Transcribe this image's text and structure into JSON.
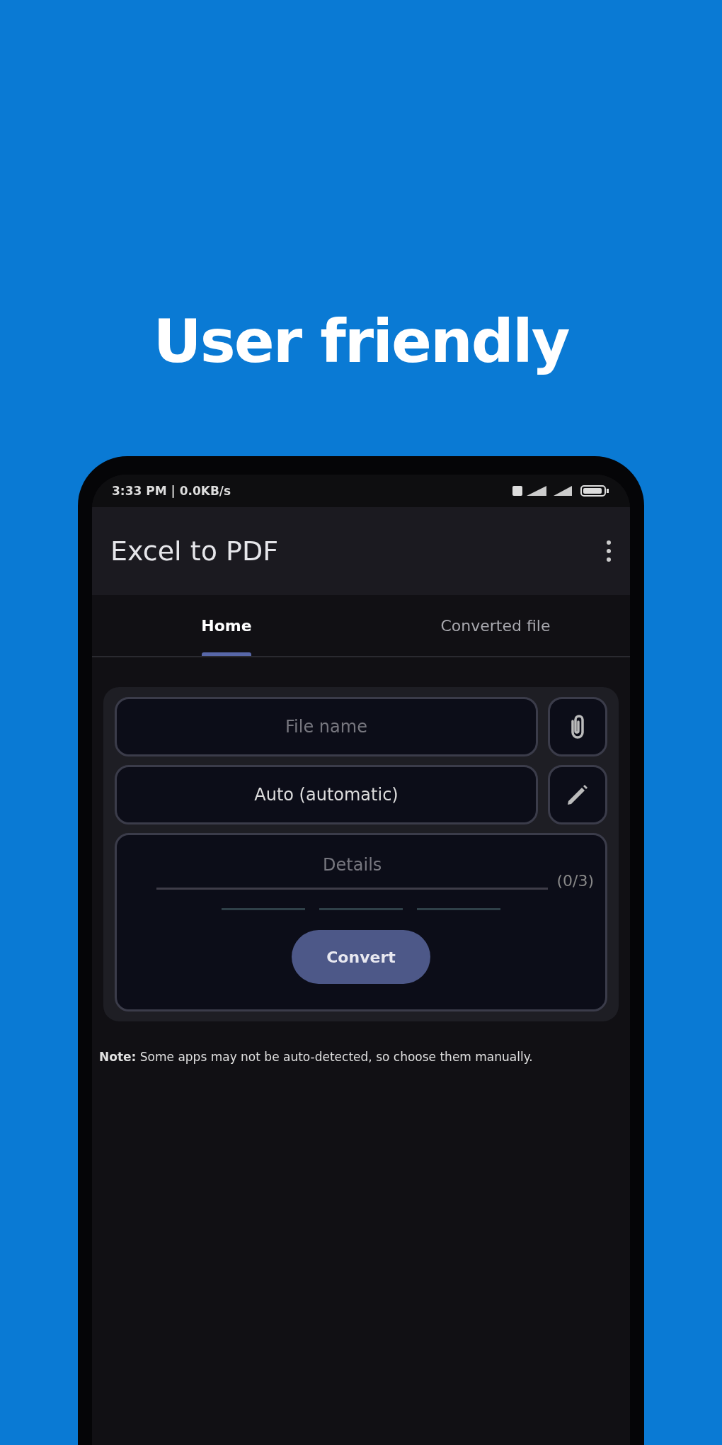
{
  "headline": "User friendly",
  "status_bar": {
    "time": "3:33 PM | 0.0KB/s"
  },
  "app_bar": {
    "title": "Excel to PDF"
  },
  "tabs": [
    {
      "label": "Home",
      "selected": true
    },
    {
      "label": "Converted file",
      "selected": false
    }
  ],
  "form": {
    "file_field": {
      "placeholder": "File name"
    },
    "mode_field": {
      "value": "Auto (automatic)"
    },
    "details": {
      "placeholder": "Details",
      "counter": "(0/3)",
      "steps": [
        {
          "done": false
        },
        {
          "done": false
        },
        {
          "done": false
        }
      ]
    },
    "convert_button": "Convert"
  },
  "note": "**Note:** Some apps may not be auto-detected, so choose them manually."
}
